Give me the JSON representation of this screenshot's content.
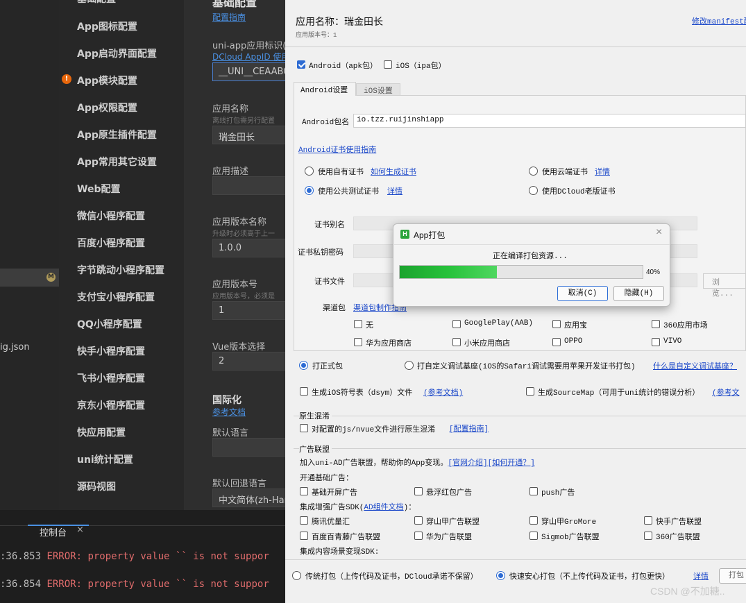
{
  "nav": {
    "items": [
      "基础配置",
      "App图标配置",
      "App启动界面配置",
      "App模块配置",
      "App权限配置",
      "App原生插件配置",
      "App常用其它设置",
      "Web配置",
      "微信小程序配置",
      "百度小程序配置",
      "字节跳动小程序配置",
      "支付宝小程序配置",
      "QQ小程序配置",
      "快手小程序配置",
      "飞书小程序配置",
      "京东小程序配置",
      "快应用配置",
      "uni统计配置",
      "源码视图"
    ],
    "warn_icon": "!"
  },
  "left": {
    "badge": "M",
    "file": "ig.json"
  },
  "form": {
    "section_title": "基础配置",
    "guide_link": "配置指南",
    "appid_label": "uni-app应用标识(A",
    "appid_link": "DCloud AppID 使用",
    "appid_value": "__UNI__CEAAB0",
    "name_label": "应用名称",
    "name_sub": "离线打包需另行配置",
    "name_value": "瑞金田长",
    "desc_label": "应用描述",
    "version_name_label": "应用版本名称",
    "version_name_sub": "升级时必须高于上一",
    "version_name_value": "1.0.0",
    "version_code_label": "应用版本号",
    "version_code_sub": "应用版本号，必须是",
    "version_code_value": "1",
    "vue_label": "Vue版本选择",
    "vue_value": "2",
    "i18n_title": "国际化",
    "i18n_link": "参考文档",
    "default_lang_label": "默认语言",
    "fallback_lang_label": "默认回退语言",
    "fallback_lang_value": "中文简体(zh-Han"
  },
  "console": {
    "tab": "控制台",
    "close": "×",
    "lines": [
      {
        "time": ":36.853",
        "msg": "ERROR: property value `` is not suppor"
      },
      {
        "time": ":36.854",
        "msg": "ERROR: property value `` is not suppor"
      }
    ]
  },
  "pack": {
    "app_name": "应用名称：瑞金田长",
    "version": "应用版本号：1",
    "manifest_link": "修改manifest配",
    "android_label": "Android（apk包）",
    "ios_label": "iOS（ipa包）",
    "tab_android": "Android设置",
    "tab_ios": "iOS设置",
    "pkg_label": "Android包名",
    "pkg_value": "io.tzz.ruijinshiapp",
    "cert_guide": "Android证书使用指南",
    "cert_own": "使用自有证书",
    "cert_how": "如何生成证书",
    "cert_cloud": "使用云端证书",
    "detail": "详情",
    "cert_public": "使用公共测试证书",
    "cert_old": "使用DCloud老版证书",
    "alias_label": "证书别名",
    "pwd_label": "证书私钥密码",
    "file_label": "证书文件",
    "browse": "浏览...",
    "channel_label": "渠道包",
    "channel_link": "渠道包制作指南",
    "channels": [
      "无",
      "GooglePlay(AAB)",
      "应用宝",
      "360应用市场",
      "华为应用商店",
      "小米应用商店",
      "OPPO",
      "VIVO"
    ],
    "formal": "打正式包",
    "custom_base": "打自定义调试基座(iOS的Safari调试需要用苹果开发证书打包)",
    "custom_q": "什么是自定义调试基座？",
    "dsym": "生成iOS符号表（dsym）文件",
    "ref_doc": "(参考文档)",
    "sourcemap": "生成SourceMap（可用于uni统计的错误分析）",
    "ref_doc2": "(参考文",
    "obf_title": "原生混淆",
    "obf_cb": "对配置的js/nvue文件进行原生混淆",
    "obf_link": "[配置指南]",
    "ad_title": "广告联盟",
    "ad_intro": "加入uni-AD广告联盟，帮助你的App变现。",
    "ad_official": "[官网介绍]",
    "ad_how": "[如何开通？]",
    "ad_basic": "开通基础广告：",
    "ad_basic_items": [
      "基础开屏广告",
      "悬浮红包广告",
      "push广告"
    ],
    "ad_sdk_prefix": "集成增强广告SDK(",
    "ad_sdk_link": "AD组件文档",
    "ad_sdk_suffix": ")：",
    "ad_sdk_items": [
      "腾讯优量汇",
      "穿山甲广告联盟",
      "穿山甲GroMore",
      "快手广告联盟",
      "百度百青藤广告联盟",
      "华为广告联盟",
      "Sigmob广告联盟",
      "360广告联盟"
    ],
    "ad_content": "集成内容场景变现SDK:",
    "mode_traditional": "传统打包（上传代码及证书，DCloud承诺不保留）",
    "mode_fast": "快速安心打包（不上传代码及证书，打包更快）",
    "mode_detail": "详情",
    "pack_btn": "打包"
  },
  "dialog": {
    "title": "App打包",
    "status": "正在编译打包资源...",
    "progress": 0.4,
    "progress_text": "40%",
    "cancel": "取消(C)",
    "hide": "隐藏(H)",
    "close": "×",
    "logo": "H"
  },
  "watermark": "CSDN @不加糖.."
}
